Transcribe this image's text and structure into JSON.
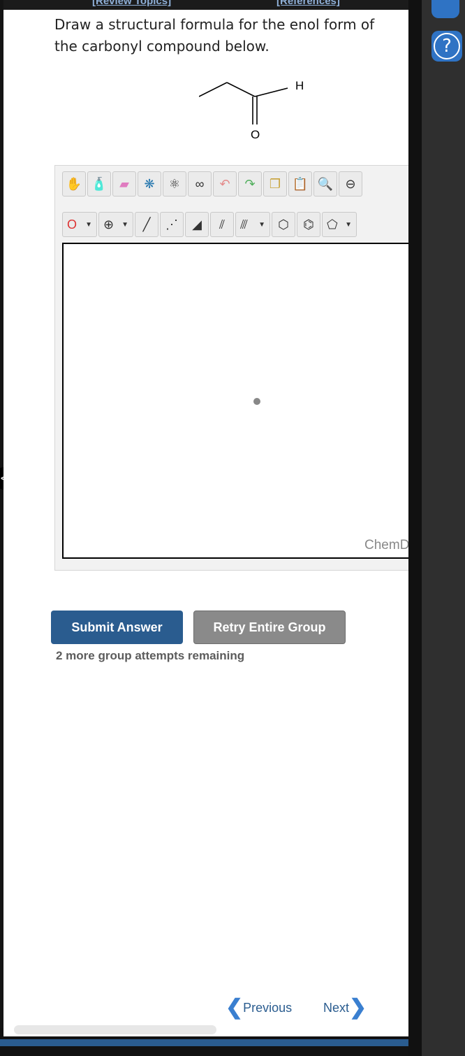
{
  "topbar": {
    "review_topics": "[Review Topics]",
    "references": "[References]"
  },
  "question": {
    "text": "Draw a structural formula for the enol form of the carbonyl compound below."
  },
  "molecule": {
    "hydrogen_label": "H",
    "oxygen_label": "O"
  },
  "editor": {
    "toolbar_row1": [
      "hand-icon",
      "bottle-icon",
      "eraser-icon",
      "lasso-icon",
      "atom-cluster-icon",
      "atom-rotate-icon",
      "undo-icon",
      "redo-icon",
      "copy-icon",
      "paste-icon",
      "zoom-in-icon",
      "zoom-out-icon"
    ],
    "toolbar_row2": [
      "element-dropdown",
      "charge-dropdown",
      "single-bond-icon",
      "dashed-bond-icon",
      "wedge-bond-icon",
      "double-bond-icon",
      "triple-bond-icon",
      "hexagon-icon",
      "benzene-icon",
      "pentagon-icon"
    ],
    "element_label": "O",
    "charge_symbol": "⊕",
    "watermark": "ChemDo"
  },
  "actions": {
    "submit_label": "Submit Answer",
    "retry_label": "Retry Entire Group",
    "attempts_text": "2 more group attempts remaining"
  },
  "nav": {
    "previous_label": "Previous",
    "next_label": "Next"
  },
  "colors": {
    "primary": "#2a5c8f",
    "retry": "#8a8a8a",
    "help": "#2f73c4"
  }
}
